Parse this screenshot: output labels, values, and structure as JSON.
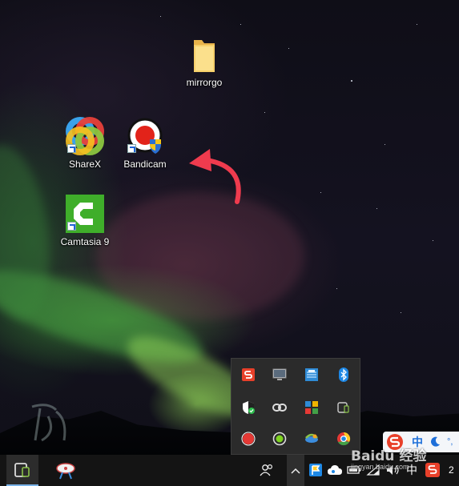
{
  "desktop": {
    "icons": [
      {
        "label": "mirrorgo",
        "icon": "folder-icon"
      },
      {
        "label": "ShareX",
        "icon": "sharex-icon"
      },
      {
        "label": "Bandicam",
        "icon": "bandicam-icon"
      },
      {
        "label": "Camtasia 9",
        "icon": "camtasia-icon"
      }
    ],
    "annotation_color": "#ef3b4e"
  },
  "tray_popup": {
    "icons": [
      "sogou-s-icon",
      "monitor-icon",
      "network-adapter-icon",
      "bluetooth-icon",
      "security-shield-icon",
      "link-chain-icon",
      "color-squares-icon",
      "phone-mirror-icon",
      "record-red-icon",
      "green-circle-icon",
      "earth-sync-icon",
      "chrome-like-icon"
    ]
  },
  "ime_toolbar": {
    "logo": "sogou-s-icon",
    "mode": "中",
    "moon": "moon-icon",
    "punct": "°,"
  },
  "taskbar": {
    "left_items": [
      "phone-mirror-icon",
      "cut-tool-icon"
    ],
    "right_items": [
      "people-icon",
      "chevron-up-icon",
      "app-flag-icon",
      "cloud-icon",
      "battery-icon",
      "wifi-icon",
      "volume-icon"
    ],
    "lang": "中",
    "watermark": "Baidu 经验",
    "watermark_sub": "jingyan.baidu.com",
    "clock_partial": "2"
  }
}
